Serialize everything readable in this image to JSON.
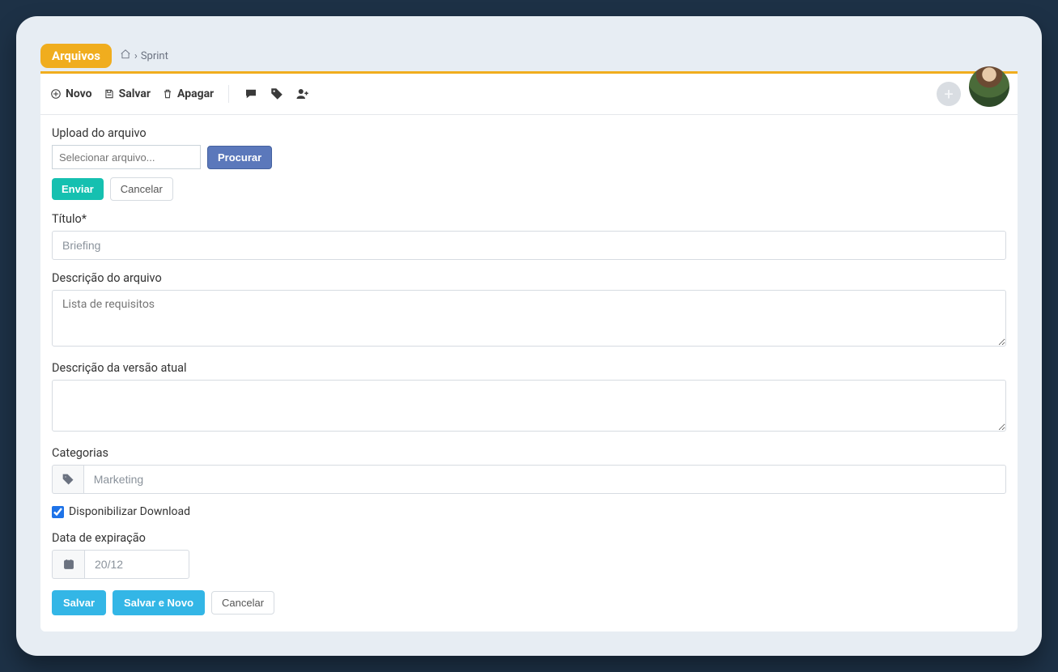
{
  "header": {
    "badge": "Arquivos",
    "breadcrumb": "Sprint"
  },
  "toolbar": {
    "novo": "Novo",
    "salvar": "Salvar",
    "apagar": "Apagar"
  },
  "form": {
    "upload_label": "Upload do arquivo",
    "file_placeholder": "Selecionar arquivo...",
    "procurar": "Procurar",
    "enviar": "Enviar",
    "cancelar": "Cancelar",
    "titulo_label": "Título*",
    "titulo_placeholder": "Briefing",
    "descricao_arquivo_label": "Descrição do arquivo",
    "descricao_arquivo_placeholder": "Lista de requisitos",
    "descricao_versao_label": "Descrição da versão atual",
    "categorias_label": "Categorias",
    "categorias_placeholder": "Marketing",
    "download_label": "Disponibilizar Download",
    "download_checked": true,
    "data_exp_label": "Data de expiração",
    "data_exp_placeholder": "20/12",
    "salvar": "Salvar",
    "salvar_novo": "Salvar e Novo",
    "cancelar_footer": "Cancelar"
  }
}
